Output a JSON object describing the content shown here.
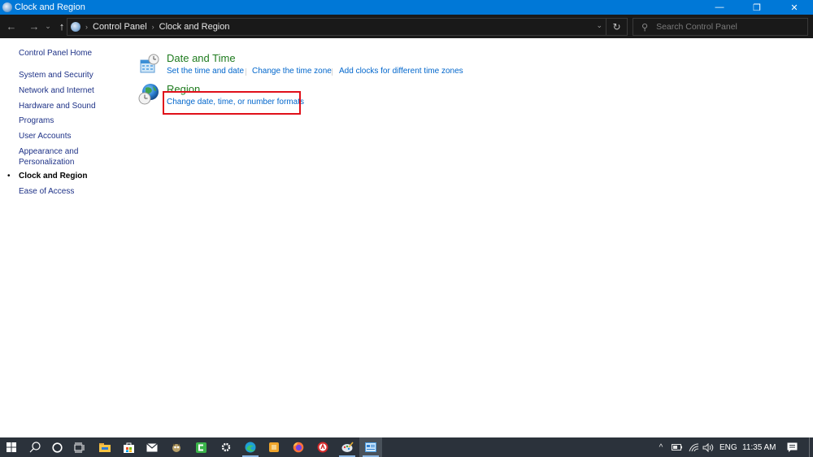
{
  "window": {
    "title": "Clock and Region",
    "controls": {
      "minimize": "—",
      "restore": "❐",
      "close": "✕"
    }
  },
  "navbar": {
    "back_icon": "←",
    "forward_icon": "→",
    "recent_icon": "⌄",
    "up_icon": "↑",
    "breadcrumb": [
      "Control Panel",
      "Clock and Region"
    ],
    "breadcrumb_sep": "›",
    "dropdown_icon": "⌄",
    "refresh_icon": "↻",
    "search_placeholder": "Search Control Panel",
    "search_icon": "⚲"
  },
  "sidebar": {
    "home": "Control Panel Home",
    "items": [
      {
        "label": "System and Security",
        "active": false
      },
      {
        "label": "Network and Internet",
        "active": false
      },
      {
        "label": "Hardware and Sound",
        "active": false
      },
      {
        "label": "Programs",
        "active": false
      },
      {
        "label": "User Accounts",
        "active": false
      },
      {
        "label": "Appearance and",
        "label2": "Personalization",
        "active": false
      },
      {
        "label": "Clock and Region",
        "active": true
      },
      {
        "label": "Ease of Access",
        "active": false
      }
    ],
    "bullet": "•"
  },
  "categories": [
    {
      "title": "Date and Time",
      "icon": "calendar-clock-icon",
      "links": [
        "Set the time and date",
        "Change the time zone",
        "Add clocks for different time zones"
      ]
    },
    {
      "title": "Region",
      "icon": "globe-clock-icon",
      "links": [
        "Change date, time, or number formats"
      ]
    }
  ],
  "highlight": {
    "color": "#e0101a",
    "target": "Change date, time, or number formats"
  },
  "taskbar": {
    "start_icon": "windows-logo",
    "search_icon": "⚲",
    "cortana_icon": "○",
    "taskview_icon": "task-view",
    "apps": [
      "file-explorer",
      "microsoft-store",
      "mail",
      "gimp",
      "camtasia",
      "settings",
      "edge",
      "app-orange",
      "firefox",
      "app-red",
      "paint",
      "control-panel"
    ],
    "tray": {
      "chevron": "^",
      "battery_icon": "battery",
      "wifi_icon": "wifi",
      "volume_icon": "volume",
      "language": "ENG",
      "time": "11:35 AM",
      "notification_icon": "action-center"
    }
  },
  "colors": {
    "titlebar": "#0078d7",
    "navbar": "#191919",
    "link": "#0066cc",
    "category_title": "#1e7b1e",
    "sidebar_link": "#1e3287",
    "taskbar": "#2b323b"
  }
}
